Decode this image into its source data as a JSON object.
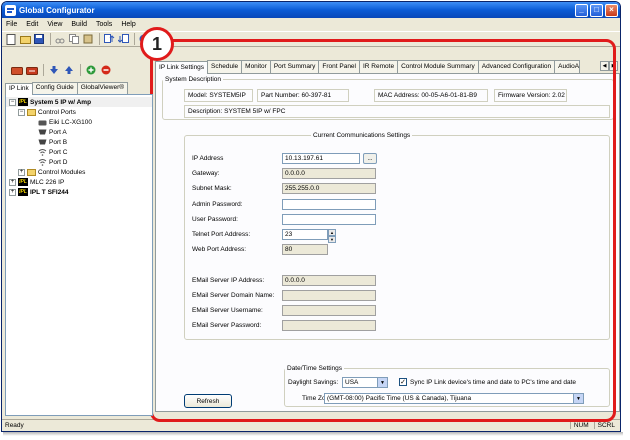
{
  "window": {
    "title": "Global Configurator",
    "minimize": "_",
    "maximize": "□",
    "close": "×"
  },
  "menu": [
    "File",
    "Edit",
    "View",
    "Build",
    "Tools",
    "Help"
  ],
  "left": {
    "tabs": [
      "IP Link",
      "Config Guide",
      "GlobalViewer®"
    ],
    "tree": {
      "root": "System 5 IP w/ Amp",
      "control_ports": "Control Ports",
      "device": "Eiki LC-XG100",
      "ports": [
        "Port A",
        "Port B",
        "Port C",
        "Port D"
      ],
      "control_modules": "Control Modules",
      "mlc": "MLC 226 IP",
      "ipl_t": "IPL T SFI244",
      "ipl_badge": "IPL"
    }
  },
  "tabs": [
    "IP Link Settings",
    "Schedule",
    "Monitor",
    "Port Summary",
    "Front Panel",
    "IR Remote",
    "Control Module Summary",
    "Advanced Configuration",
    "AudioA"
  ],
  "system_description": {
    "legend": "System Description",
    "model": "Model:  SYSTEM5IP",
    "part_number": "Part Number:  60-397-81",
    "mac": "MAC Address:  00-05-A6-01-81-B9",
    "firmware": "Firmware Version:  2.02",
    "description": "Description:  SYSTEM 5IP w/ FPC"
  },
  "comm_settings": {
    "legend": "Current Communications Settings",
    "ip_label": "IP Address",
    "ip_value": "10.13.197.61",
    "ip_button": "...",
    "gateway_label": "Gateway:",
    "gateway_value": "0.0.0.0",
    "subnet_label": "Subnet Mask:",
    "subnet_value": "255.255.0.0",
    "admin_pw_label": "Admin Password:",
    "admin_pw_value": "",
    "user_pw_label": "User Password:",
    "user_pw_value": "",
    "telnet_label": "Telnet Port Address:",
    "telnet_value": "23",
    "web_label": "Web Port Address:",
    "web_value": "80",
    "email_ip_label": "EMail Server IP Address:",
    "email_ip_value": "0.0.0.0",
    "email_domain_label": "EMail Server Domain Name:",
    "email_user_label": "EMail Server Username:",
    "email_pw_label": "EMail Server Password:"
  },
  "datetime": {
    "legend": "Date/Time Settings",
    "dst_label": "Daylight Savings:",
    "dst_value": "USA",
    "sync_label": "Sync IP Link device's time and date to PC's time and date",
    "sync_checked": true,
    "sync_mark": "✓",
    "tz_label": "Time Zone:",
    "tz_value": "(GMT-08:00) Pacific Time (US & Canada), Tijuana"
  },
  "refresh_label": "Refresh",
  "status": {
    "text": "Ready",
    "indicators": [
      "NUM",
      "SCRL"
    ]
  },
  "callout": "1",
  "colors": {
    "highlight": "#e01b1b",
    "title_bar": "#0a5bd6",
    "window_bg": "#ece9d8"
  }
}
